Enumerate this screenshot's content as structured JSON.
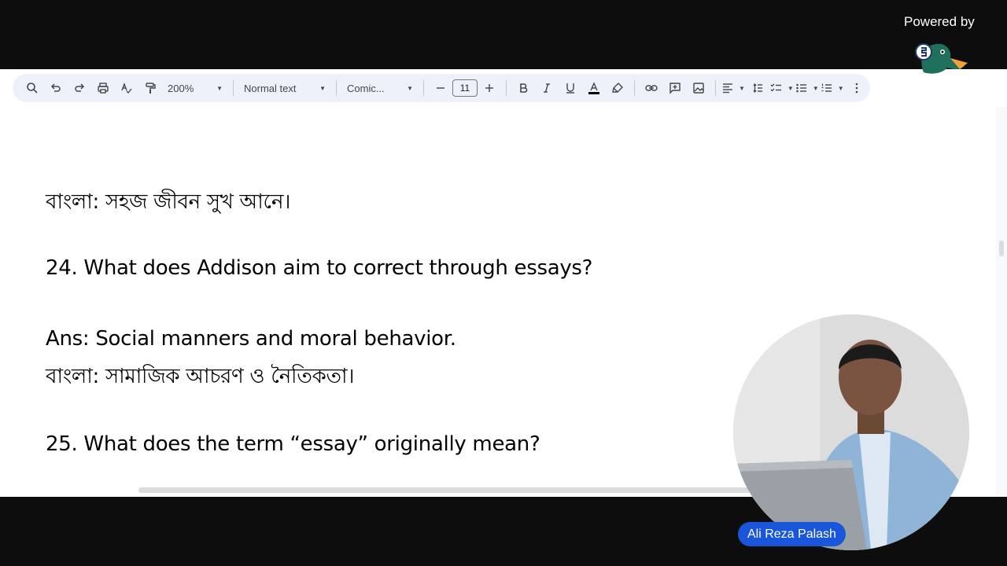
{
  "toolbar": {
    "zoom": "200%",
    "style": "Normal text",
    "font": "Comic...",
    "font_size": "11"
  },
  "document": {
    "lines": [
      "বাংলা: সহজ জীবন সুখ আনে।",
      "24. What does Addison aim to correct through essays?",
      "Ans: Social manners and moral behavior.",
      "বাংলা: সামাজিক আচরণ ও নৈতিকতা।",
      "25. What does the term “essay” originally mean?"
    ]
  },
  "overlay": {
    "powered_by": "Powered by",
    "brand": "StreamYard",
    "presenter_name": "Ali Reza Palash"
  }
}
